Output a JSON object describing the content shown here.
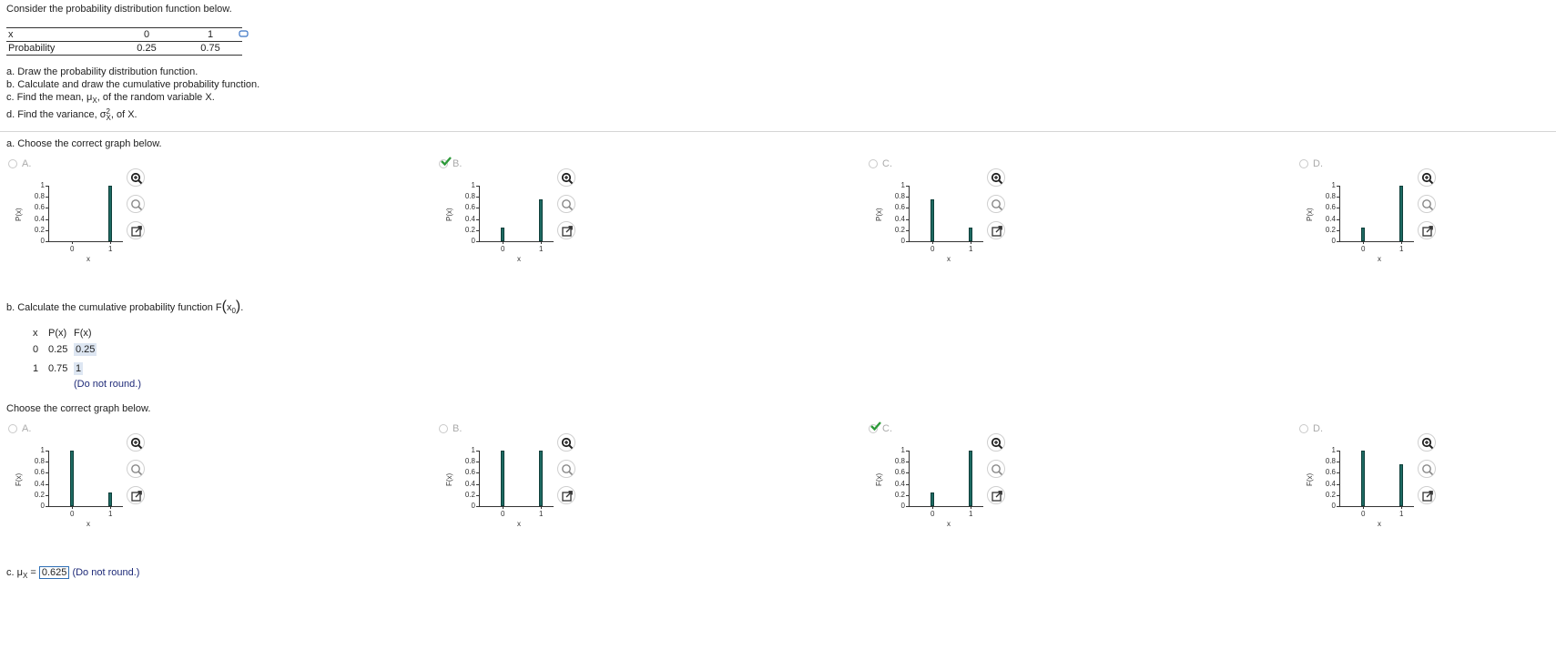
{
  "intro": "Consider the probability distribution function below.",
  "dist_table": {
    "row_x": [
      "x",
      "0",
      "1"
    ],
    "row_p": [
      "Probability",
      "0.25",
      "0.75"
    ]
  },
  "copy_icon": "copy-data-icon",
  "questions": {
    "a": "a. Draw the probability distribution function.",
    "b": "b. Calculate and draw the cumulative probability function.",
    "c_pre": "c. Find the mean, ",
    "c_sym": "μ",
    "c_sub": "X",
    "c_post": ", of the random variable X.",
    "d_pre": "d. Find the variance, ",
    "d_sym": "σ",
    "d_sup": "2",
    "d_sub": "X",
    "d_post": ", of X."
  },
  "part_a": {
    "prompt": "a. Choose the correct graph below.",
    "ylabel": "P(x)",
    "xlabel": "x",
    "yticks": [
      "1",
      "0.8",
      "0.6",
      "0.4",
      "0.2",
      "0"
    ],
    "xticks": [
      "0",
      "1"
    ],
    "options": [
      {
        "letter": "A.",
        "selected": false,
        "values": [
          0,
          1
        ]
      },
      {
        "letter": "B.",
        "selected": true,
        "values": [
          0.25,
          0.75
        ]
      },
      {
        "letter": "C.",
        "selected": false,
        "values": [
          0.75,
          0.25
        ]
      },
      {
        "letter": "D.",
        "selected": false,
        "values": [
          0.25,
          1
        ]
      }
    ]
  },
  "part_b": {
    "prompt_pre": "b. Calculate the cumulative probability function F",
    "prompt_arg": "x",
    "prompt_sub": "0",
    "prompt_post": ".",
    "headers": [
      "x",
      "P(x)",
      "F(x)"
    ],
    "rows": [
      {
        "x": "0",
        "p": "0.25",
        "f": "0.25"
      },
      {
        "x": "1",
        "p": "0.75",
        "f": "1"
      }
    ],
    "hint": "(Do not round.)",
    "graph_prompt": "Choose the correct graph below.",
    "ylabel": "F(x)",
    "xlabel": "x",
    "yticks": [
      "1",
      "0.8",
      "0.6",
      "0.4",
      "0.2",
      "0"
    ],
    "xticks": [
      "0",
      "1"
    ],
    "options": [
      {
        "letter": "A.",
        "selected": false,
        "values": [
          1,
          0.25
        ]
      },
      {
        "letter": "B.",
        "selected": false,
        "values": [
          1,
          1
        ]
      },
      {
        "letter": "C.",
        "selected": true,
        "values": [
          0.25,
          1
        ]
      },
      {
        "letter": "D.",
        "selected": false,
        "values": [
          1,
          0.75
        ]
      }
    ]
  },
  "part_c": {
    "label_pre": "c. ",
    "sym": "μ",
    "sub": "X",
    "eq": " = ",
    "answer": "0.625",
    "hint": "(Do not round.)"
  },
  "colors": {
    "bar": "#1d6a62",
    "check": "#2e9a3a",
    "divider": "#d5d5d5"
  }
}
